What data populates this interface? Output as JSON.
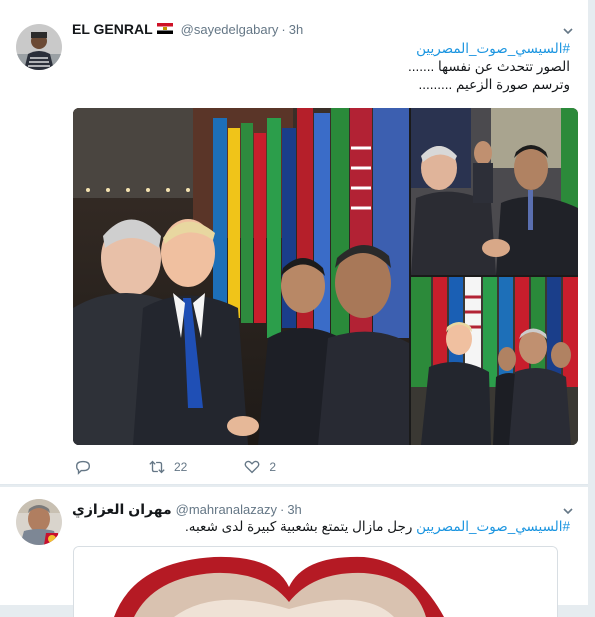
{
  "tweets": [
    {
      "display_name": "EL GENRAL",
      "flag": "egypt-flag",
      "handle": "@sayedelgabary",
      "separator": "·",
      "time": "3h",
      "hashtag": "#السيسي_صوت_المصريين",
      "line1": "الصور تتحدث عن نفسها .......",
      "line2": "وترسم صورة الزعيم .........",
      "actions": {
        "reply_icon": "reply-icon",
        "retweet_icon": "retweet-icon",
        "retweet_count": "22",
        "like_icon": "heart-icon",
        "like_count": "2"
      }
    },
    {
      "display_name": "مهران العزازي",
      "handle": "@mahranalazazy",
      "separator": "·",
      "time": "3h",
      "hashtag": "#السيسي_صوت_المصريين",
      "text": " رجل مازال يتمتع بشعبية كبيرة لدى شعبه."
    }
  ],
  "colors": {
    "link": "#1b95e0",
    "muted": "#657786",
    "background": "#e6ecf0"
  }
}
